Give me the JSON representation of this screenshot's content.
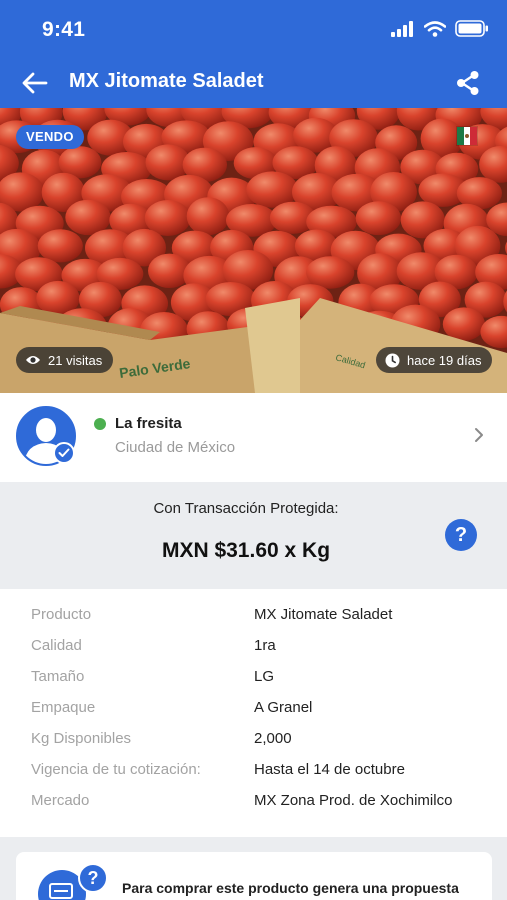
{
  "status_bar": {
    "time": "9:41",
    "icons": [
      "signal-icon",
      "wifi-icon",
      "battery-icon"
    ]
  },
  "header": {
    "title": "MX Jitomate Saladet",
    "back_icon": "arrow-left-icon",
    "share_icon": "share-icon"
  },
  "hero": {
    "badge": "VENDO",
    "country_flag": "mexico-flag",
    "visits": "21 visitas",
    "posted": "hace 19 días"
  },
  "seller": {
    "name": "La fresita",
    "location": "Ciudad de México",
    "status": "online"
  },
  "price": {
    "label": "Con Transacción Protegida:",
    "value": "MXN $31.60 x Kg",
    "help": "?"
  },
  "details": [
    {
      "label": "Producto",
      "value": "MX Jitomate Saladet"
    },
    {
      "label": "Calidad",
      "value": "1ra"
    },
    {
      "label": "Tamaño",
      "value": "LG"
    },
    {
      "label": "Empaque",
      "value": "A Granel"
    },
    {
      "label": "Kg Disponibles",
      "value": "2,000"
    },
    {
      "label": "Vigencia de tu cotización:",
      "value": "Hasta el 14 de octubre"
    },
    {
      "label": "Mercado",
      "value": "MX Zona Prod. de Xochimilco"
    }
  ],
  "proposal": {
    "help": "?",
    "text": "Para comprar este producto genera una propuesta"
  },
  "colors": {
    "brand": "#2f6ad8",
    "online": "#4caf50",
    "muted": "#a3a3a3",
    "panel": "#ebedf0"
  }
}
